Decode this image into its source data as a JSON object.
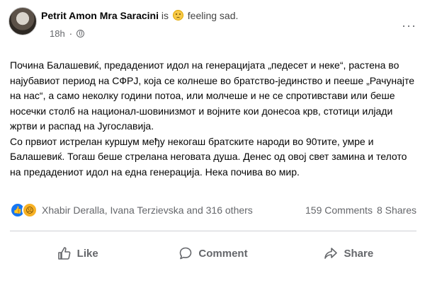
{
  "post": {
    "author": "Petrit Amon Mra Saracini",
    "is_text": "is",
    "feeling": "feeling sad.",
    "time": "18h",
    "more_icon": "···",
    "paragraphs": [
      "Почина Балашевиќ, предадениот идол на генерацијата „педесет и неке“, растена во најубавиот период на СФРЈ, која се колнеше во братство-јединство и пееше „Рачунајте на нас“, а само неколку години потоа, или молчеше и не се спротивстави или беше носечки столб на национал-шовинизмот и војните кои донесоа крв, стотици илјади жртви и распад на Југославија.",
      "Со првиот истрелан куршум међу некогаш братските народи во 90тите, умре и Балашевиќ. Тогаш беше стрелана неговата душа. Денес од овој свет замина и телото на предадениот идол на една генерација. Нека почива во мир."
    ]
  },
  "reactions": {
    "names": "Xhabir Deralla, Ivana Terzievska and 316 others",
    "comments": "159 Comments",
    "shares": "8 Shares"
  },
  "actions": {
    "like": "Like",
    "comment": "Comment",
    "share": "Share"
  }
}
